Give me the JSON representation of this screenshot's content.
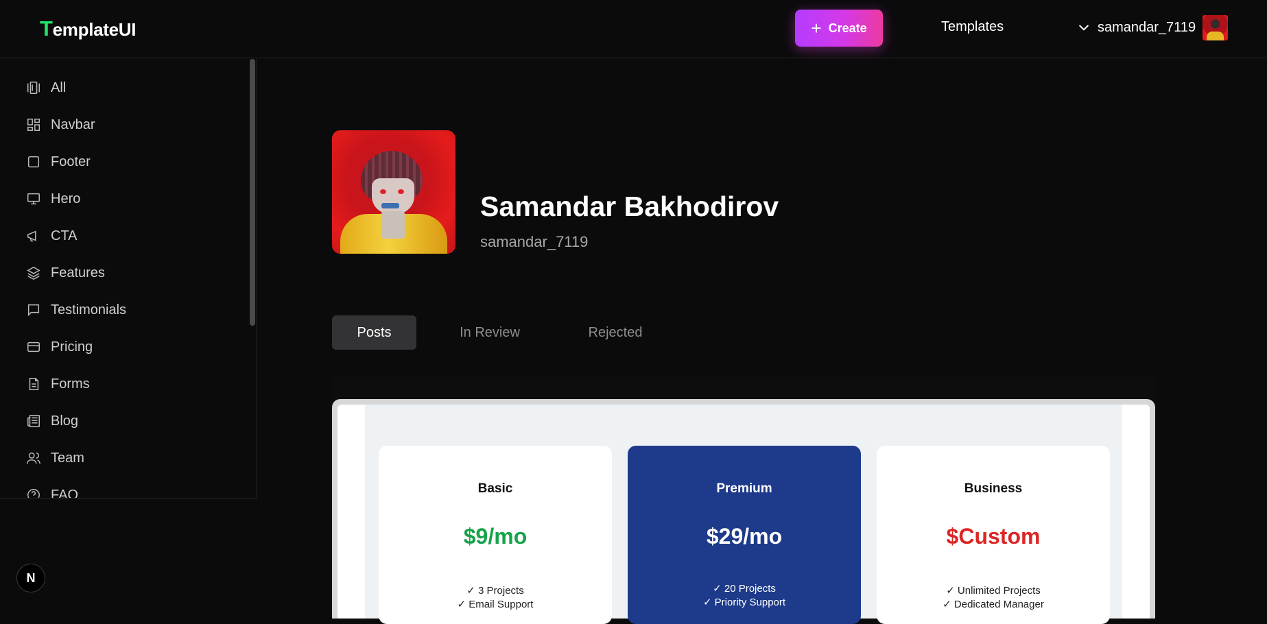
{
  "header": {
    "logo_first": "T",
    "logo_rest": "emplateUI",
    "create_label": "Create",
    "templates_label": "Templates",
    "username": "samandar_7119"
  },
  "sidebar": {
    "items": [
      {
        "label": "All",
        "icon": "library-icon"
      },
      {
        "label": "Navbar",
        "icon": "layout-dashboard-icon"
      },
      {
        "label": "Footer",
        "icon": "square-icon"
      },
      {
        "label": "Hero",
        "icon": "monitor-icon"
      },
      {
        "label": "CTA",
        "icon": "megaphone-icon"
      },
      {
        "label": "Features",
        "icon": "layers-icon"
      },
      {
        "label": "Testimonials",
        "icon": "message-square-icon"
      },
      {
        "label": "Pricing",
        "icon": "credit-card-icon"
      },
      {
        "label": "Forms",
        "icon": "file-text-icon"
      },
      {
        "label": "Blog",
        "icon": "newspaper-icon"
      },
      {
        "label": "Team",
        "icon": "users-icon"
      },
      {
        "label": "FAQ",
        "icon": "help-circle-icon"
      }
    ]
  },
  "profile": {
    "name": "Samandar Bakhodirov",
    "handle": "samandar_7119"
  },
  "tabs": [
    {
      "label": "Posts",
      "active": true
    },
    {
      "label": "In Review",
      "active": false
    },
    {
      "label": "Rejected",
      "active": false
    }
  ],
  "preview": {
    "plans": [
      {
        "name": "Basic",
        "price": "$9/mo",
        "price_color": "#16a34a",
        "features": [
          "✓ 3 Projects",
          "✓ Email Support"
        ]
      },
      {
        "name": "Premium",
        "price": "$29/mo",
        "price_color": "#ffffff",
        "features": [
          "✓ 20 Projects",
          "✓ Priority Support"
        ]
      },
      {
        "name": "Business",
        "price": "$Custom",
        "price_color": "#dc2626",
        "features": [
          "✓ Unlimited Projects",
          "✓ Dedicated Manager"
        ]
      }
    ]
  },
  "badge": {
    "label": "N"
  },
  "colors": {
    "accent_gradient_start": "#b53cff",
    "accent_gradient_end": "#ec3aa0",
    "logo_green": "#22e36a",
    "premium_blue": "#1e3a8a"
  }
}
